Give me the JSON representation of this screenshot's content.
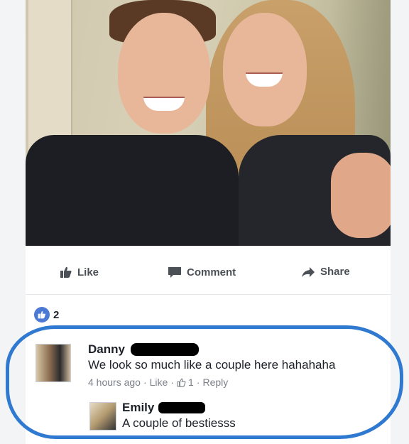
{
  "actions": {
    "like_label": "Like",
    "comment_label": "Comment",
    "share_label": "Share"
  },
  "reactions": {
    "count": "2"
  },
  "comments": [
    {
      "author": "Danny",
      "text": "We look so much like a couple here hahahaha",
      "time": "4 hours ago",
      "like_link": "Like",
      "like_count": "1",
      "reply_link": "Reply"
    },
    {
      "author": "Emily",
      "text": "A couple of bestiesss"
    }
  ],
  "colors": {
    "highlight": "#2f79d0",
    "like_blue": "#4b79d4"
  }
}
